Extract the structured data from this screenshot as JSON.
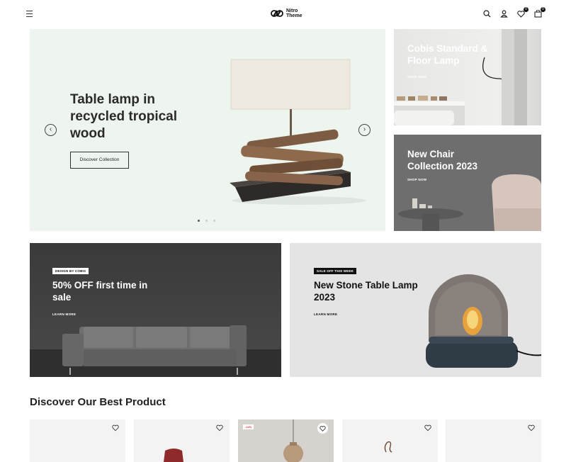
{
  "header": {
    "brand_line1": "Nitro",
    "brand_line2": "Theme",
    "wishlist_count": "0",
    "cart_count": "0"
  },
  "hero": {
    "title": "Table lamp in recycled tropical wood",
    "button_label": "Discover Collection",
    "prev_symbol": "‹",
    "next_symbol": "›",
    "slides_total": 3,
    "active_slide": 1
  },
  "side_banners": [
    {
      "title": "Cobis Standard & Floor Lamp",
      "link": "SHOP NOW"
    },
    {
      "title": "New Chair Collection 2023",
      "link": "SHOP NOW"
    }
  ],
  "promo_banners": [
    {
      "tag": "DESIGN BY COBIS",
      "title": "50% OFF first time in sale",
      "link": "LEARN MORE"
    },
    {
      "tag": "SALE OFF THIS WEEK",
      "title": "New Stone Table Lamp 2023",
      "link": "LEARN MORE"
    }
  ],
  "section": {
    "title": "Discover Our Best Product"
  },
  "products": [
    {
      "sale_badge": ""
    },
    {
      "sale_badge": ""
    },
    {
      "sale_badge": "-14%"
    },
    {
      "sale_badge": ""
    },
    {
      "sale_badge": ""
    }
  ],
  "icons": {
    "menu": "hamburger-icon",
    "search": "search-icon",
    "account": "user-icon",
    "wishlist": "heart-icon",
    "cart": "cart-icon"
  },
  "colors": {
    "hero_bg": "#eef5ef",
    "dark_banner": "#3a3a3a",
    "light_banner": "#e4e4e4",
    "text": "#222222"
  }
}
